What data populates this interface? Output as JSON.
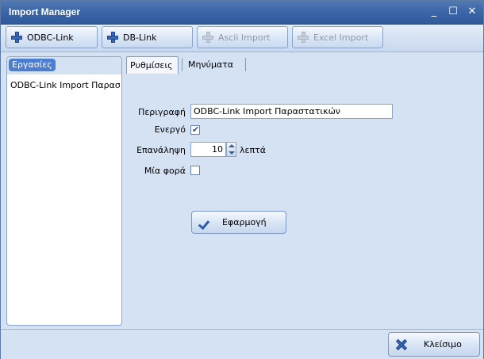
{
  "window": {
    "title": "Import Manager",
    "minimize": "_",
    "maximize": "☐",
    "close": "✕"
  },
  "toolbar": {
    "buttons": [
      {
        "label": "ODBC-Link",
        "icon": "plus-icon",
        "enabled": true
      },
      {
        "label": "DB-Link",
        "icon": "plus-icon",
        "enabled": true
      },
      {
        "label": "Ascii Import",
        "icon": "plus-icon",
        "enabled": false
      },
      {
        "label": "Excel Import",
        "icon": "plus-icon",
        "enabled": false
      }
    ]
  },
  "tasks": {
    "header": "Εργασίες",
    "items": [
      {
        "label": "ODBC-Link Import Παραστατικών"
      }
    ]
  },
  "tabs": [
    {
      "label": "Ρυθμίσεις",
      "active": true
    },
    {
      "label": "Μηνύματα",
      "active": false
    }
  ],
  "settings": {
    "description_label": "Περιγραφή",
    "description_value": "ODBC-Link Import Παραστατικών",
    "active_label": "Ενεργό",
    "active_checked": true,
    "active_mark": "✔",
    "repeat_label": "Επανάληψη",
    "repeat_value": "10",
    "repeat_unit": "λεπτά",
    "once_label": "Μία φορά",
    "once_checked": false,
    "apply_label": "Εφαρμογή"
  },
  "footer": {
    "close_label": "Κλείσιμο"
  },
  "colors": {
    "titlebar": "#3b65a6",
    "background": "#d5e2f3",
    "accent": "#4c7dcf"
  }
}
